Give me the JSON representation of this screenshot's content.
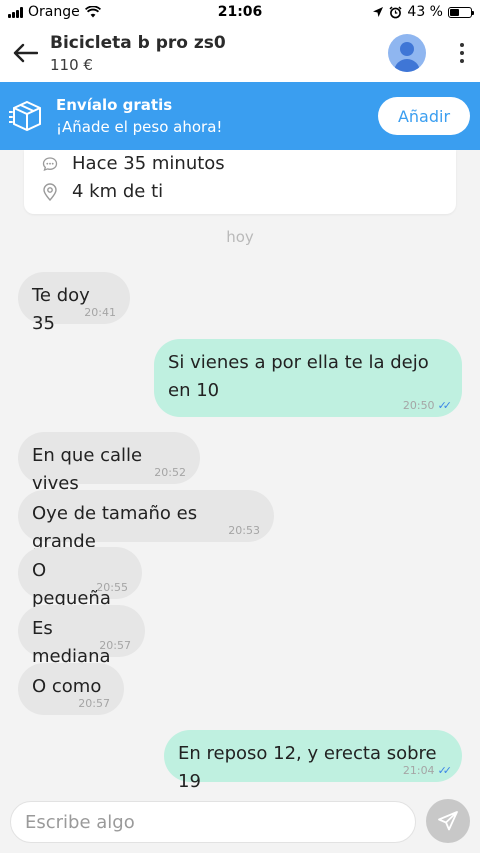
{
  "status_bar": {
    "carrier": "Orange",
    "time": "21:06",
    "battery": "43 %",
    "battery_level": 0.43
  },
  "header": {
    "title": "Bicicleta b pro zs0",
    "price": "110 €"
  },
  "shipping_banner": {
    "title": "Envíalo gratis",
    "subtitle": "¡Añade el peso ahora!",
    "button_label": "Añadir"
  },
  "info_card": {
    "posted": "Hace 35 minutos",
    "distance": "4 km de ti"
  },
  "day_label": "hoy",
  "messages": [
    {
      "text": "Te doy 35",
      "time": "20:41",
      "direction": "in"
    },
    {
      "text": "Si vienes a por ella te la dejo en 10",
      "time": "20:50",
      "direction": "out"
    },
    {
      "text": "En que calle vives",
      "time": "20:52",
      "direction": "in"
    },
    {
      "text": "Oye de tamaño es grande",
      "time": "20:53",
      "direction": "in"
    },
    {
      "text": "O pequeña",
      "time": "20:55",
      "direction": "in"
    },
    {
      "text": "Es mediana",
      "time": "20:57",
      "direction": "in"
    },
    {
      "text": "O como",
      "time": "20:57",
      "direction": "in"
    },
    {
      "text": "En reposo 12, y erecta sobre 19",
      "time": "21:04",
      "direction": "out"
    }
  ],
  "input": {
    "placeholder": "Escribe algo",
    "value": ""
  },
  "colors": {
    "banner": "#3a9ef0",
    "incoming_bubble": "#e6e6e6",
    "outgoing_bubble": "#bff0e0",
    "read_ticks": "#3d86e6"
  }
}
